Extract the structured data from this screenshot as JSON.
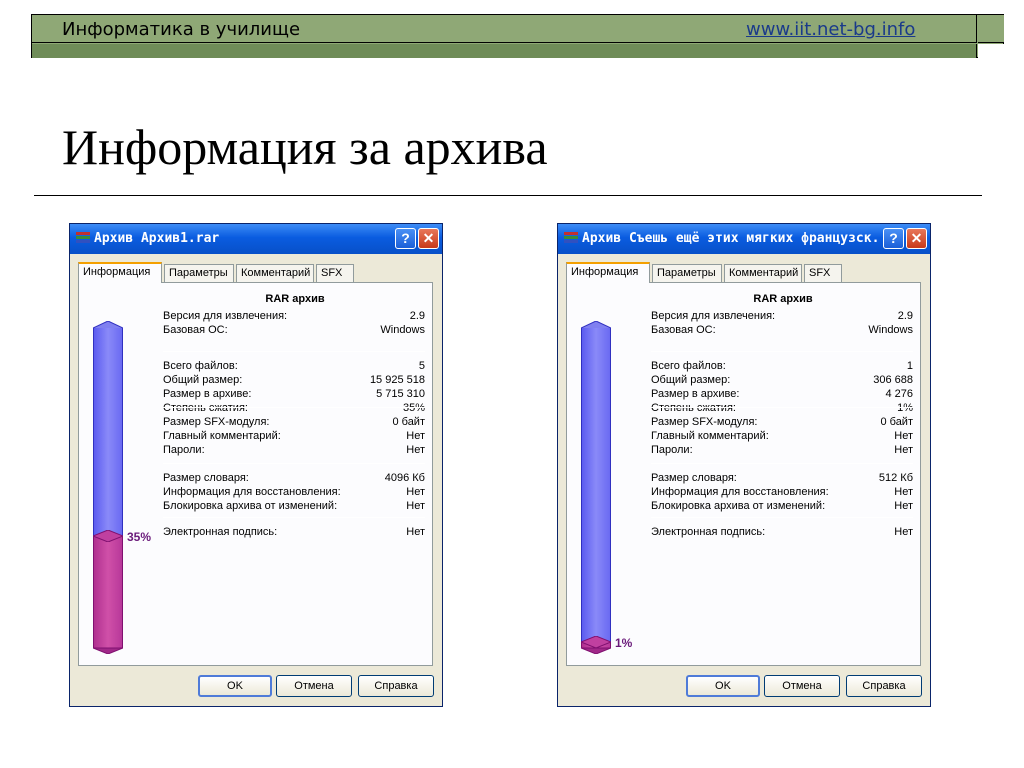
{
  "header": {
    "title": "Информатика в училище",
    "url": "www.iit.net-bg.info"
  },
  "slide_title": "Информация за архива",
  "dialogs": [
    {
      "title": "Архив Архив1.rar",
      "tabs": [
        "Информация",
        "Параметры",
        "Комментарий",
        "SFX"
      ],
      "heading": "RAR архив",
      "compression_fraction": 0.35,
      "percent_label": "35%",
      "groups": [
        [
          {
            "label": "Версия для извлечения:",
            "value": "2.9"
          },
          {
            "label": "Базовая ОС:",
            "value": "Windows"
          }
        ],
        [
          {
            "label": "Всего файлов:",
            "value": "5"
          },
          {
            "label": "Общий размер:",
            "value": "15 925 518"
          },
          {
            "label": "Размер в архиве:",
            "value": "5 715 310"
          },
          {
            "label": "Степень сжатия:",
            "value": "35%"
          }
        ],
        [
          {
            "label": "Размер SFX-модуля:",
            "value": "0 байт"
          },
          {
            "label": "Главный комментарий:",
            "value": "Нет"
          },
          {
            "label": "Пароли:",
            "value": "Нет"
          }
        ],
        [
          {
            "label": "Размер словаря:",
            "value": "4096 Кб"
          },
          {
            "label": "Информация для восстановления:",
            "value": "Нет"
          },
          {
            "label": "Блокировка архива от изменений:",
            "value": "Нет"
          }
        ],
        [
          {
            "label": "Электронная подпись:",
            "value": "Нет"
          }
        ]
      ],
      "buttons": {
        "ok": "OK",
        "cancel": "Отмена",
        "help": "Справка"
      }
    },
    {
      "title": "Архив Съешь ещё этих мягких французск...",
      "tabs": [
        "Информация",
        "Параметры",
        "Комментарий",
        "SFX"
      ],
      "heading": "RAR архив",
      "compression_fraction": 0.01,
      "percent_label": "1%",
      "groups": [
        [
          {
            "label": "Версия для извлечения:",
            "value": "2.9"
          },
          {
            "label": "Базовая ОС:",
            "value": "Windows"
          }
        ],
        [
          {
            "label": "Всего файлов:",
            "value": "1"
          },
          {
            "label": "Общий размер:",
            "value": "306 688"
          },
          {
            "label": "Размер в архиве:",
            "value": "4 276"
          },
          {
            "label": "Степень сжатия:",
            "value": "1%"
          }
        ],
        [
          {
            "label": "Размер SFX-модуля:",
            "value": "0 байт"
          },
          {
            "label": "Главный комментарий:",
            "value": "Нет"
          },
          {
            "label": "Пароли:",
            "value": "Нет"
          }
        ],
        [
          {
            "label": "Размер словаря:",
            "value": "512 Кб"
          },
          {
            "label": "Информация для восстановления:",
            "value": "Нет"
          },
          {
            "label": "Блокировка архива от изменений:",
            "value": "Нет"
          }
        ],
        [
          {
            "label": "Электронная подпись:",
            "value": "Нет"
          }
        ]
      ],
      "buttons": {
        "ok": "OK",
        "cancel": "Отмена",
        "help": "Справка"
      }
    }
  ]
}
